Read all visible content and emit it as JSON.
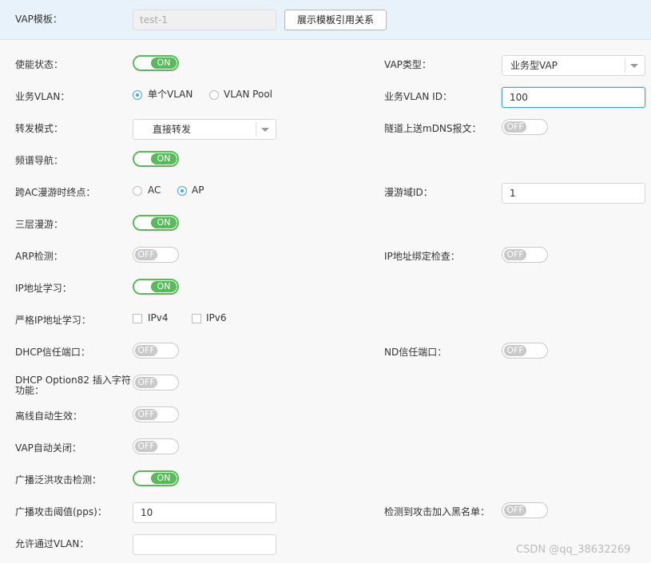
{
  "header": {
    "vap_template_label": "VAP模板：",
    "vap_template_value": "test-1",
    "show_reference_button": "展示模板引用关系"
  },
  "left": {
    "enable_state": {
      "label": "使能状态：",
      "state": "ON"
    },
    "service_vlan": {
      "label": "业务VLAN：",
      "options": [
        "单个VLAN",
        "VLAN Pool"
      ],
      "selected": "单个VLAN"
    },
    "forward_mode": {
      "label": "转发模式：",
      "value": "直接转发"
    },
    "band_steering": {
      "label": "频谱导航：",
      "state": "ON"
    },
    "cross_ac_roam": {
      "label": "跨AC漫游时终点：",
      "options": [
        "AC",
        "AP"
      ],
      "selected": "AP"
    },
    "l3_roam": {
      "label": "三层漫游：",
      "state": "ON"
    },
    "arp_detect": {
      "label": "ARP检测：",
      "state": "OFF"
    },
    "ip_learning": {
      "label": "IP地址学习：",
      "state": "ON"
    },
    "strict_ip_learning": {
      "label": "严格IP地址学习：",
      "options": [
        "IPv4",
        "IPv6"
      ]
    },
    "dhcp_trust_port": {
      "label": "DHCP信任端口：",
      "state": "OFF"
    },
    "dhcp_option82": {
      "label": "DHCP Option82 插入字符功能：",
      "state": "OFF"
    },
    "offline_auto_effect": {
      "label": "离线自动生效：",
      "state": "OFF"
    },
    "vap_auto_close": {
      "label": "VAP自动关闭：",
      "state": "OFF"
    },
    "broadcast_flood_detect": {
      "label": "广播泛洪攻击检测：",
      "state": "ON"
    },
    "broadcast_threshold": {
      "label": "广播攻击阈值(pps)：",
      "value": "10"
    },
    "allowed_vlan": {
      "label": "允许通过VLAN：",
      "value": ""
    }
  },
  "right": {
    "vap_type": {
      "label": "VAP类型：",
      "value": "业务型VAP"
    },
    "service_vlan_id": {
      "label": "业务VLAN ID：",
      "value": "100"
    },
    "tunnel_mdns": {
      "label": "隧道上送mDNS报文：",
      "state": "OFF"
    },
    "roam_domain_id": {
      "label": "漫游域ID：",
      "value": "1"
    },
    "ip_binding_check": {
      "label": "IP地址绑定检查：",
      "state": "OFF"
    },
    "nd_trust_port": {
      "label": "ND信任端口：",
      "state": "OFF"
    },
    "attack_blacklist": {
      "label": "检测到攻击加入黑名单：",
      "state": "OFF"
    }
  },
  "watermark": "CSDN @qq_38632269",
  "colors": {
    "header_bg": "#e7f2fb",
    "on_green": "#5cb85c",
    "radio_blue": "#4aa3df",
    "focus_blue": "#4a9fd8"
  }
}
